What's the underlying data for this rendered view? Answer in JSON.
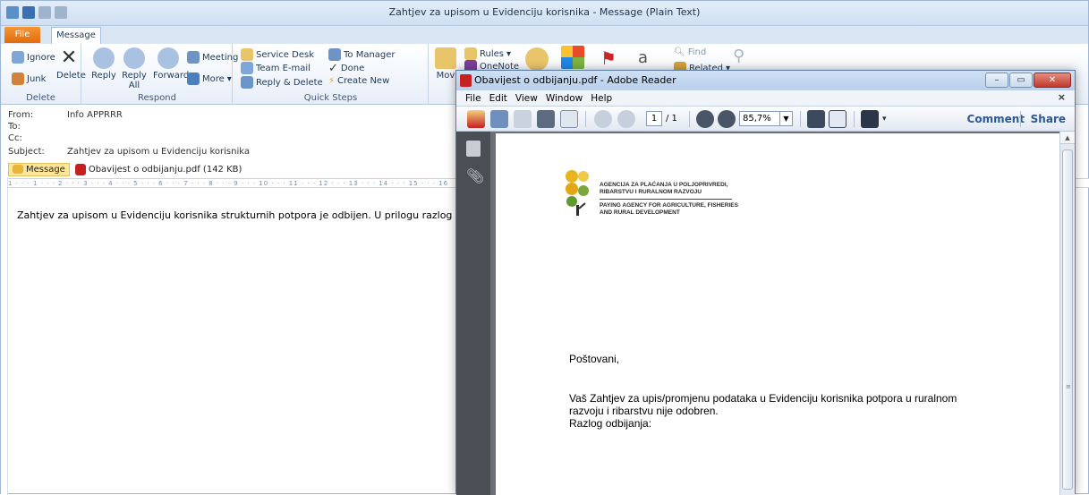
{
  "outlook": {
    "window_title": "Zahtjev za upisom u Evidenciju korisnika - Message (Plain Text)",
    "tabs": {
      "file": "File",
      "message": "Message"
    },
    "ribbon": {
      "delete_group": {
        "label": "Delete",
        "ignore": "Ignore",
        "junk": "Junk",
        "delete": "Delete"
      },
      "respond_group": {
        "label": "Respond",
        "reply": "Reply",
        "reply_all": "Reply All",
        "forward": "Forward",
        "meeting": "Meeting",
        "more": "More"
      },
      "quick_steps_group": {
        "label": "Quick Steps",
        "items": [
          "Service Desk",
          "Team E-mail",
          "Reply & Delete",
          "To Manager",
          "Done",
          "Create New"
        ]
      },
      "move_group": {
        "move": "Mov",
        "rules": "Rules",
        "onenote": "OneNote"
      },
      "editing": {
        "find": "Find",
        "related": "Related"
      }
    },
    "header": {
      "from_label": "From:",
      "from_value": "Info APPRRR",
      "to_label": "To:",
      "cc_label": "Cc:",
      "subject_label": "Subject:",
      "subject_value": "Zahtjev za upisom u Evidenciju korisnika"
    },
    "attachments": {
      "message_tab": "Message",
      "file": "Obavijest o odbijanju.pdf (142 KB)"
    },
    "ruler_text": "1 · · · 1 · · · 2 · · · 3 · · · 4 · · · 5 · · · 6 · · · 7 · · · 8 · · · 9 · · · 10 · · · 11 · · · 12 · · · 13 · · · 14 · · · 15 · · · 16",
    "body": "Zahtjev za upisom u Evidenciju korisnika strukturnih potpora je odbijen. U prilogu razlog odbijanja."
  },
  "reader": {
    "window_title": "Obavijest o odbijanju.pdf - Adobe Reader",
    "menu": [
      "File",
      "Edit",
      "View",
      "Window",
      "Help"
    ],
    "toolbar": {
      "page_current": "1",
      "page_total": "/ 1",
      "zoom": "85,7%",
      "comment": "Comment",
      "share": "Share"
    },
    "pdf": {
      "agency_hr_line1": "AGENCIJA ZA PLAĆANJA U POLJOPRIVREDI,",
      "agency_hr_line2": "RIBARSTVU I RURALNOM RAZVOJU",
      "agency_en_line1": "PAYING AGENCY FOR AGRICULTURE, FISHERIES",
      "agency_en_line2": "AND RURAL DEVELOPMENT",
      "greeting": "Poštovani,",
      "paragraph_line1": "Vaš Zahtjev za upis/promjenu podataka u Evidenciju korisnika potpora u ruralnom",
      "paragraph_line2": "razvoju i ribarstvu nije odobren.",
      "paragraph_line3": "Razlog odbijanja:"
    }
  },
  "colors": {
    "accent_orange": "#e06c0d",
    "reader_blue": "#2b5a97",
    "logo_yellow": "#e8b41f",
    "logo_green": "#7aa83a"
  }
}
